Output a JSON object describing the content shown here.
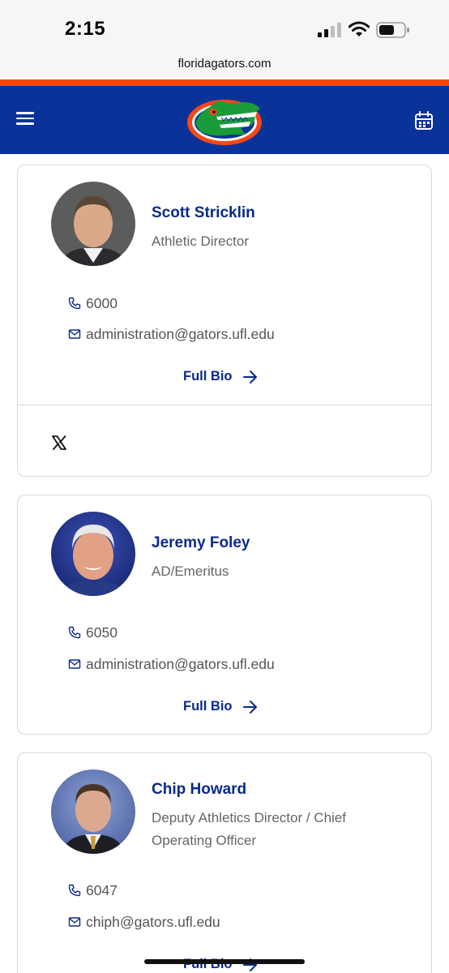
{
  "status_bar": {
    "time": "2:15"
  },
  "browser": {
    "url": "floridagators.com"
  },
  "header": {
    "brand_color": "#0a3399",
    "accent_color": "#fa4616",
    "menu_icon": "hamburger-menu-icon",
    "logo": "gator-head-logo",
    "calendar_icon": "calendar-icon"
  },
  "staff": [
    {
      "name": "Scott Stricklin",
      "title": "Athletic Director",
      "phone": "6000",
      "email": "administration@gators.ufl.edu",
      "bio_label": "Full Bio",
      "social": [
        "x-icon"
      ]
    },
    {
      "name": "Jeremy Foley",
      "title": "AD/Emeritus",
      "phone": "6050",
      "email": "administration@gators.ufl.edu",
      "bio_label": "Full Bio"
    },
    {
      "name": "Chip Howard",
      "title": "Deputy Athletics Director / Chief Operating Officer",
      "phone": "6047",
      "email": "chiph@gators.ufl.edu",
      "bio_label": "Full Bio"
    }
  ]
}
